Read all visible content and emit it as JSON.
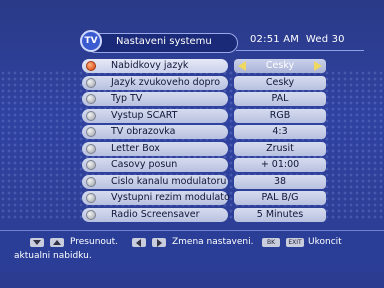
{
  "header": {
    "logo_text": "TV",
    "title": "Nastaveni systemu",
    "time": "02:51 AM",
    "day": "Wed 30"
  },
  "menu": {
    "items": [
      {
        "label": "Nabidkovy jazyk",
        "value": "Cesky",
        "selected": true
      },
      {
        "label": "Jazyk zvukoveho dopro",
        "value": "Cesky",
        "selected": false
      },
      {
        "label": "Typ TV",
        "value": "PAL",
        "selected": false
      },
      {
        "label": "Vystup SCART",
        "value": "RGB",
        "selected": false
      },
      {
        "label": "TV obrazovka",
        "value": "4:3",
        "selected": false
      },
      {
        "label": "Letter Box",
        "value": "Zrusit",
        "selected": false
      },
      {
        "label": "Casovy posun",
        "value": "+ 01:00",
        "selected": false
      },
      {
        "label": "Cislo kanalu modulatoru",
        "value": "38",
        "selected": false
      },
      {
        "label": "Vystupni rezim modulato",
        "value": "PAL B/G",
        "selected": false
      },
      {
        "label": "Radio Screensaver",
        "value": "5 Minutes",
        "selected": false
      }
    ]
  },
  "footer": {
    "move_label": "Presunout.",
    "change_label": "Zmena nastaveni.",
    "exit_label": "Ukoncit",
    "exit_label_2": "aktualni nabidku.",
    "key_back": "BK",
    "key_exit": "EXIT"
  },
  "colors": {
    "background": "#2c3d8c",
    "highlight_dot": "#d6400f",
    "arrow": "#f0d860"
  }
}
